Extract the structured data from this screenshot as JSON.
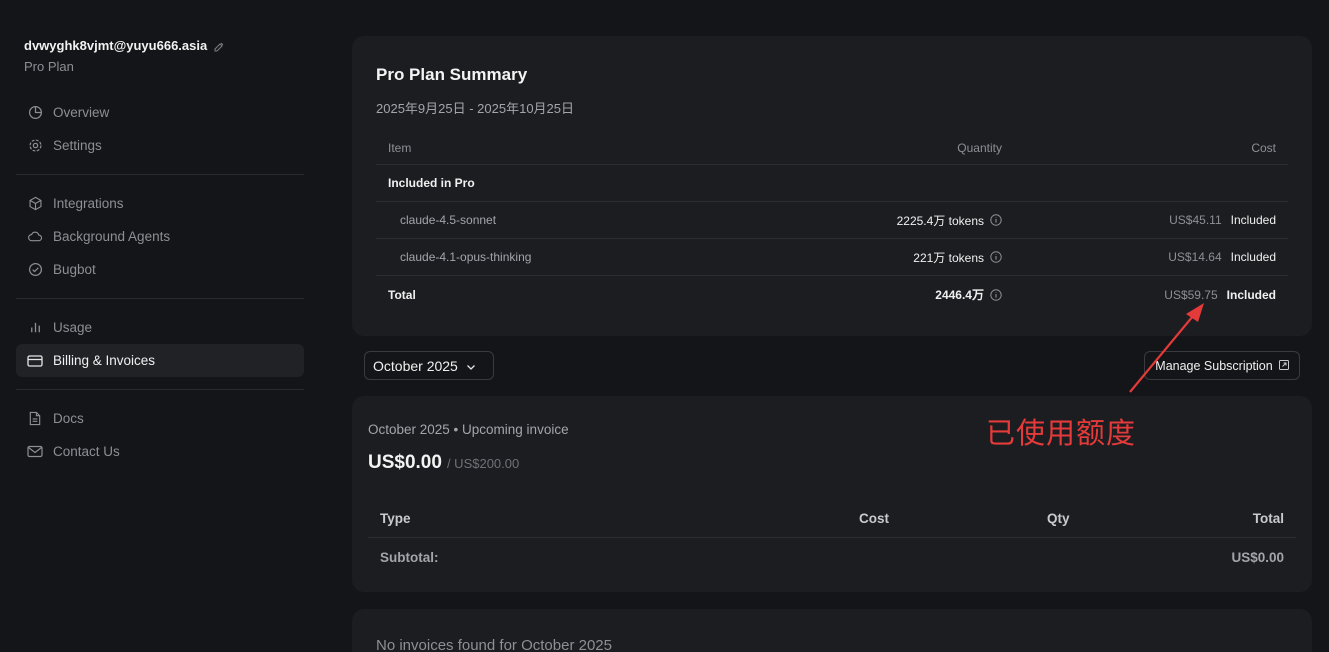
{
  "account": {
    "email": "dvwyghk8vjmt@yuyu666.asia",
    "plan": "Pro Plan"
  },
  "nav": {
    "group1": [
      {
        "label": "Overview",
        "icon": "pie-chart-icon"
      },
      {
        "label": "Settings",
        "icon": "gear-icon"
      }
    ],
    "group2": [
      {
        "label": "Integrations",
        "icon": "cube-icon"
      },
      {
        "label": "Background Agents",
        "icon": "cloud-icon"
      },
      {
        "label": "Bugbot",
        "icon": "check-circle-icon"
      }
    ],
    "group3": [
      {
        "label": "Usage",
        "icon": "bar-chart-icon"
      },
      {
        "label": "Billing & Invoices",
        "icon": "credit-card-icon",
        "active": true
      }
    ],
    "group4": [
      {
        "label": "Docs",
        "icon": "document-icon"
      },
      {
        "label": "Contact Us",
        "icon": "mail-icon"
      }
    ]
  },
  "summary": {
    "title": "Pro Plan Summary",
    "dates": "2025年9月25日 - 2025年10月25日",
    "headers": {
      "item": "Item",
      "quantity": "Quantity",
      "cost": "Cost"
    },
    "section": "Included in Pro",
    "rows": [
      {
        "item": "claude-4.5-sonnet",
        "quantity": "2225.4万 tokens",
        "cost": "US$45.11",
        "status": "Included"
      },
      {
        "item": "claude-4.1-opus-thinking",
        "quantity": "221万 tokens",
        "cost": "US$14.64",
        "status": "Included"
      }
    ],
    "total": {
      "label": "Total",
      "quantity": "2446.4万",
      "cost": "US$59.75",
      "status": "Included"
    }
  },
  "month_select": {
    "value": "October 2025"
  },
  "manage_subscription": {
    "label": "Manage Subscription"
  },
  "invoice": {
    "heading": "October 2025 • Upcoming invoice",
    "amount": "US$0.00",
    "limit": "/ US$200.00",
    "headers": {
      "type": "Type",
      "cost": "Cost",
      "qty": "Qty",
      "total": "Total"
    },
    "subtotal": {
      "label": "Subtotal:",
      "value": "US$0.00"
    }
  },
  "empty": {
    "text": "No invoices found for October 2025"
  },
  "annotation": {
    "text": "已使用额度",
    "color": "#e53a3a"
  },
  "colors": {
    "background": "#141518",
    "card": "#1c1d21",
    "muted": "#8d8f94"
  }
}
